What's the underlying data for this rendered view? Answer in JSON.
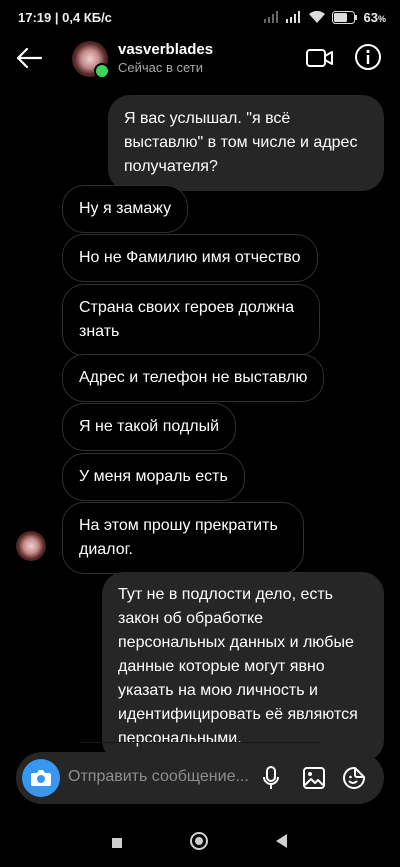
{
  "status_bar": {
    "time_speed": "17:19 | 0,4 КБ/с",
    "battery": "63"
  },
  "header": {
    "username": "vasverblades",
    "status": "Сейчас в сети"
  },
  "messages": [
    {
      "dir": "out",
      "text": "Я вас услышал. \"я всё выставлю\" в том числе и адрес получателя?"
    },
    {
      "dir": "in",
      "text": "Ну я замажу"
    },
    {
      "dir": "in",
      "text": "Но не Фамилию имя отчество"
    },
    {
      "dir": "in",
      "text": "Страна своих героев должна знать"
    },
    {
      "dir": "in",
      "text": "Адрес и телефон не выставлю"
    },
    {
      "dir": "in",
      "text": "Я не такой подлый"
    },
    {
      "dir": "in",
      "text": "У меня мораль есть"
    },
    {
      "dir": "in",
      "text": "На этом прошу прекратить диалог."
    },
    {
      "dir": "out",
      "text": "Тут не в подлости дело, есть закон об обработке персональных данных и любые данные которые могут явно указать на мою личность и идентифицировать её являются персональными."
    }
  ],
  "composer": {
    "placeholder": "Отправить сообщение..."
  },
  "icons": {
    "back": "arrow-left-icon",
    "video": "video-camera-icon",
    "info": "info-icon",
    "camera": "camera-icon",
    "mic": "microphone-icon",
    "gallery": "image-icon",
    "sticker": "sticker-icon"
  },
  "colors": {
    "background": "#000000",
    "outgoing_bubble": "#262626",
    "incoming_border": "#2f2f2f",
    "accent": "#3897f0",
    "online": "#3ed35a"
  }
}
